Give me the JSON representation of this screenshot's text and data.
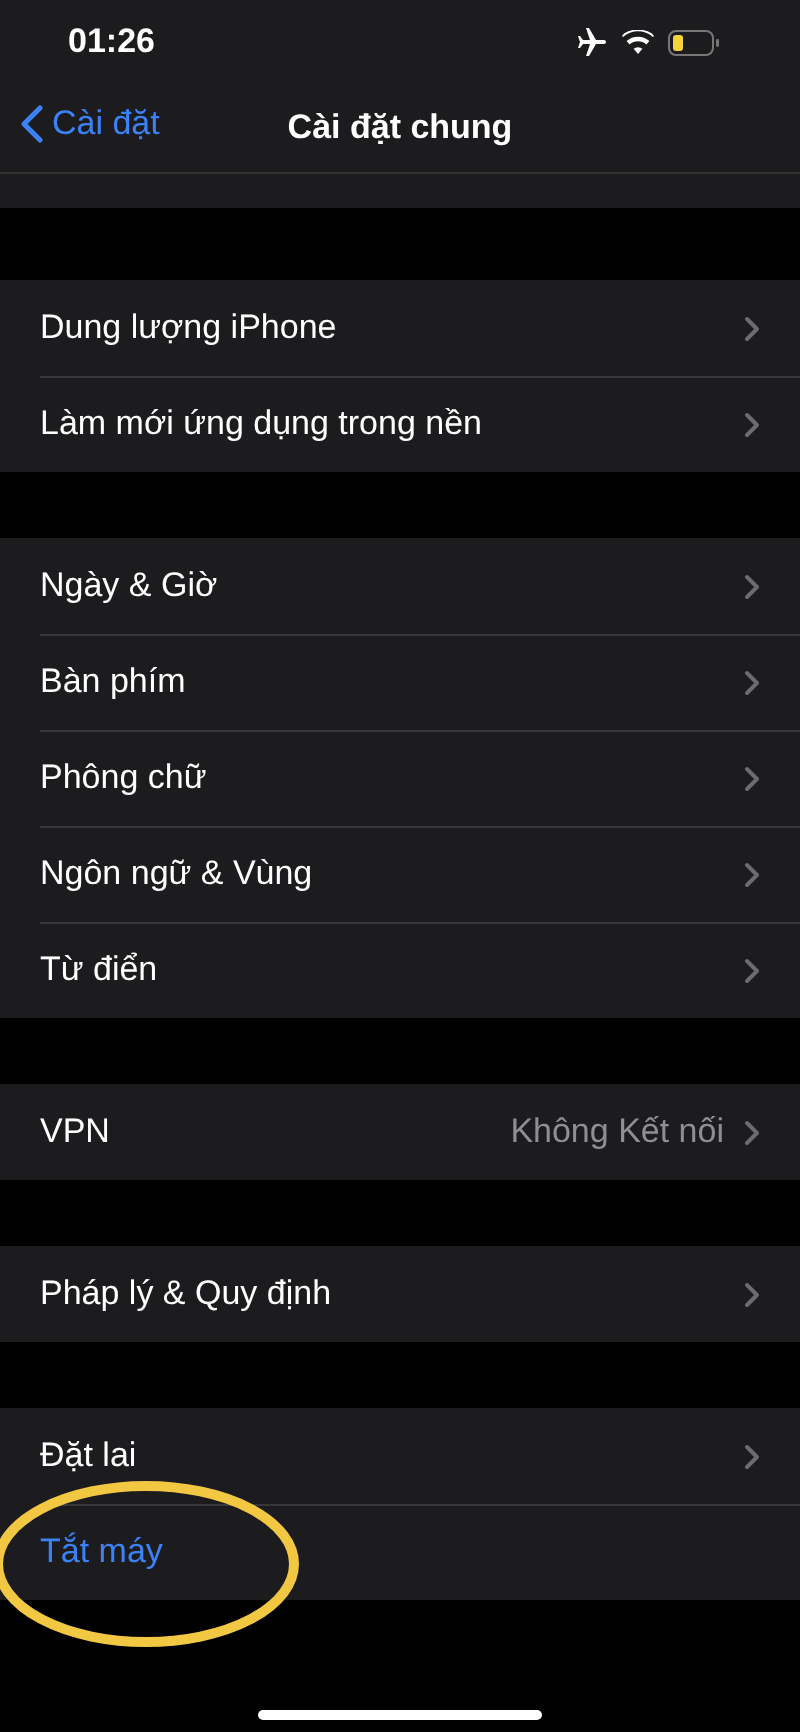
{
  "status_bar": {
    "time": "01:26"
  },
  "nav": {
    "back": "Cài đặt",
    "title": "Cài đặt chung"
  },
  "groups": [
    {
      "rows": [
        {
          "kind": "link",
          "label": "Dung lượng iPhone"
        },
        {
          "kind": "link",
          "label": "Làm mới ứng dụng trong nền"
        }
      ]
    },
    {
      "rows": [
        {
          "kind": "link",
          "label": "Ngày & Giờ"
        },
        {
          "kind": "link",
          "label": "Bàn phím"
        },
        {
          "kind": "link",
          "label": "Phông chữ"
        },
        {
          "kind": "link",
          "label": "Ngôn ngữ & Vùng"
        },
        {
          "kind": "link",
          "label": "Từ điển"
        }
      ]
    },
    {
      "rows": [
        {
          "kind": "link",
          "label": "VPN",
          "value": "Không Kết nối"
        }
      ]
    },
    {
      "rows": [
        {
          "kind": "link",
          "label": "Pháp lý & Quy định"
        }
      ]
    },
    {
      "rows": [
        {
          "kind": "link",
          "label": "Đặt lai"
        },
        {
          "kind": "action",
          "label": "Tắt máy",
          "highlighted": true
        }
      ]
    }
  ]
}
